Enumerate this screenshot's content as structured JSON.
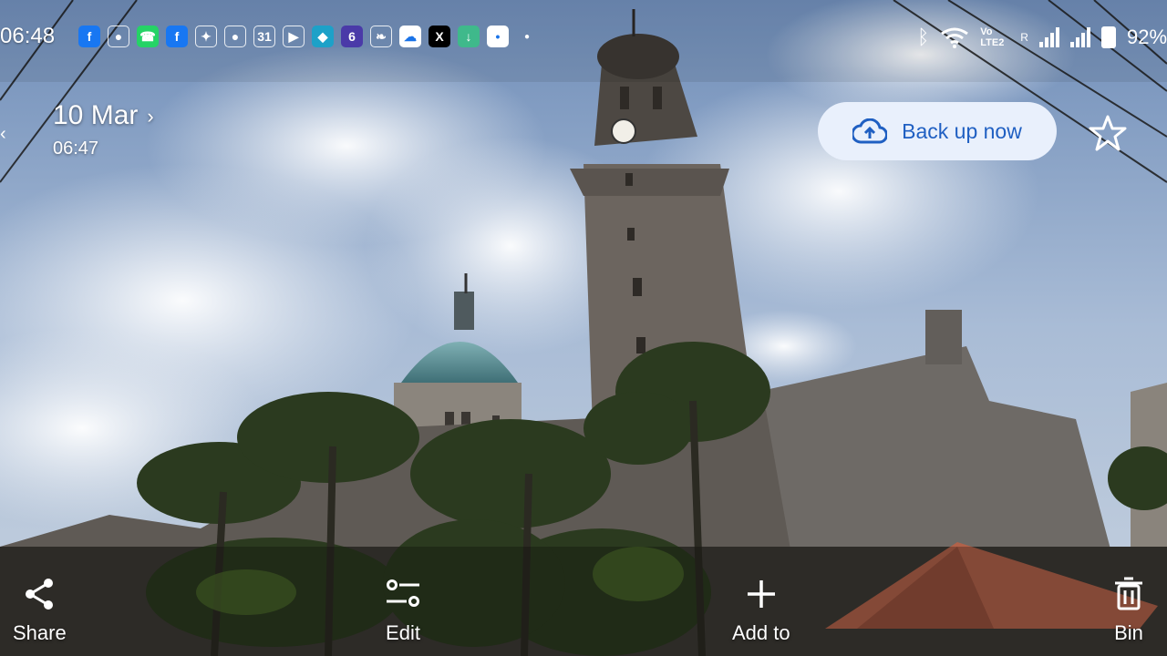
{
  "status_bar": {
    "time": "06:48",
    "notification_icons": [
      {
        "icon": "facebook-icon",
        "glyph": "f",
        "color": "#1877f2"
      },
      {
        "icon": "chat-bubble-icon",
        "glyph": "●",
        "color": "transparent"
      },
      {
        "icon": "whatsapp-icon",
        "glyph": "☎",
        "color": "#25d366"
      },
      {
        "icon": "facebook-icon",
        "glyph": "f",
        "color": "#1877f2"
      },
      {
        "icon": "pinwheel-icon",
        "glyph": "✦",
        "color": "transparent"
      },
      {
        "icon": "chat-bubble-icon",
        "glyph": "●",
        "color": "transparent"
      },
      {
        "icon": "calendar-icon",
        "glyph": "31",
        "color": "transparent"
      },
      {
        "icon": "youtube-icon",
        "glyph": "▶",
        "color": "transparent"
      },
      {
        "icon": "app-blue-icon",
        "glyph": "◆",
        "color": "#1da1c8"
      },
      {
        "icon": "game-icon",
        "glyph": "6",
        "color": "#4a3aa8"
      },
      {
        "icon": "leaf-icon",
        "glyph": "❧",
        "color": "transparent"
      },
      {
        "icon": "cloud-icon",
        "glyph": "☁",
        "color": "#ffffff"
      },
      {
        "icon": "x-icon",
        "glyph": "X",
        "color": "#000000"
      },
      {
        "icon": "download-icon",
        "glyph": "↓",
        "color": "#3fb98b"
      },
      {
        "icon": "app-white-icon",
        "glyph": "•",
        "color": "#ffffff"
      }
    ],
    "volte_label": "Vo LTE2",
    "roaming_label": "R",
    "battery": "92"
  },
  "header": {
    "date": "10 Mar",
    "time": "06:47",
    "backup_label": "Back up now"
  },
  "actions": {
    "share": "Share",
    "edit": "Edit",
    "add_to": "Add to",
    "bin": "Bin"
  },
  "colors": {
    "backup_bg": "#e9f0fc",
    "backup_text": "#1f5fc2"
  }
}
